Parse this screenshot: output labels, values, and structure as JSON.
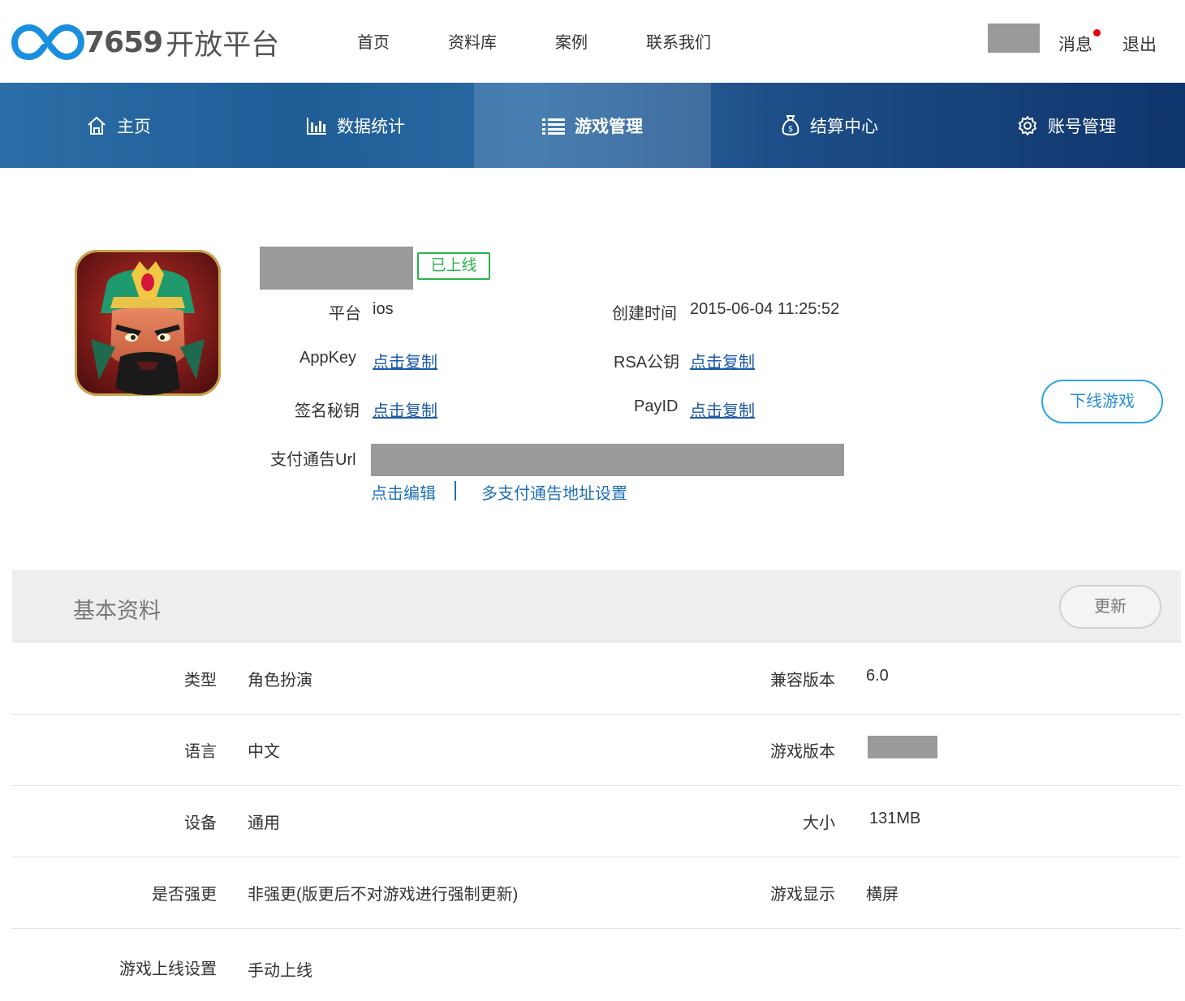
{
  "header": {
    "logo_number": "7659",
    "logo_text": "开放平台",
    "nav": [
      "首页",
      "资料库",
      "案例",
      "联系我们"
    ],
    "message_label": "消息",
    "logout_label": "退出",
    "message_dot_color": "#e60012"
  },
  "main_nav": {
    "items": [
      {
        "label": "主页",
        "icon": "home-icon"
      },
      {
        "label": "数据统计",
        "icon": "bar-chart-icon"
      },
      {
        "label": "游戏管理",
        "icon": "list-icon",
        "active": true
      },
      {
        "label": "结算中心",
        "icon": "money-bag-icon"
      },
      {
        "label": "账号管理",
        "icon": "gear-icon"
      }
    ]
  },
  "game": {
    "status": "已上线",
    "platform_label": "平台",
    "platform_value": "ios",
    "created_label": "创建时间",
    "created_value": "2015-06-04 11:25:52",
    "appkey_label": "AppKey",
    "appkey_link": "点击复制",
    "rsa_label": "RSA公钥",
    "rsa_link": "点击复制",
    "secret_label": "签名秘钥",
    "secret_link": "点击复制",
    "payid_label": "PayID",
    "payid_link": "点击复制",
    "pay_url_label": "支付通告Url",
    "edit_link": "点击编辑",
    "multi_url_link": "多支付通告地址设置",
    "offline_button": "下线游戏"
  },
  "basic_info": {
    "title": "基本资料",
    "update_button": "更新",
    "rows": [
      {
        "label1": "类型",
        "value1": "角色扮演",
        "label2": "兼容版本",
        "value2": "6.0"
      },
      {
        "label1": "语言",
        "value1": "中文",
        "label2": "游戏版本",
        "value2": ""
      },
      {
        "label1": "设备",
        "value1": "通用",
        "label2": "大小",
        "value2": "131MB"
      },
      {
        "label1": "是否强更",
        "value1": "非强更(版更后不对游戏进行强制更新)",
        "label2": "游戏显示",
        "value2": "横屏"
      },
      {
        "label1": "游戏上线设置",
        "value1": "手动上线",
        "label2": "",
        "value2": ""
      }
    ]
  },
  "colors": {
    "status_green": "#2bb24c",
    "link_blue": "#1e5aa8",
    "nav_dark": "#10356d",
    "logo_blue": "#1a8fe0"
  }
}
